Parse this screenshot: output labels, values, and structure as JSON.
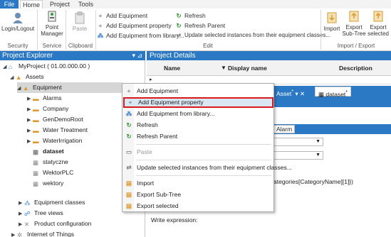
{
  "ribbon_tabs": [
    "File",
    "Home",
    "Project",
    "Tools"
  ],
  "ribbon": {
    "login_logout": "Login/Logout",
    "point_manager_l1": "Point",
    "point_manager_l2": "Manager",
    "paste": "Paste",
    "add_equipment": "Add Equipment",
    "add_equipment_property": "Add Equipment property",
    "add_equipment_from_library": "Add Equipment from library...",
    "refresh": "Refresh",
    "refresh_parent": "Refresh Parent",
    "update_selected": "Update selected instances from their equipment classes...",
    "import": "Import",
    "export_subtree_l1": "Export",
    "export_subtree_l2": "Sub-Tree",
    "export_selected_l1": "Export",
    "export_selected_l2": "selected",
    "groups": {
      "security": "Security",
      "service": "Service",
      "clipboard": "Clipboard",
      "edit": "Edit",
      "import_export": "Import / Export"
    }
  },
  "project_explorer": {
    "title": "Project Explorer",
    "tree": {
      "project": "MyProject ( 01.00.000.00 )",
      "assets": "Assets",
      "equipment": "Equipment",
      "children": [
        "Alarms",
        "Company",
        "GenDemoRoot",
        "Water Treatment",
        "WaterIrrigation",
        "dataset",
        "statyczne",
        "WektorPLC",
        "wektory"
      ],
      "equipment_classes": "Equipment classes",
      "tree_views": "Tree views",
      "product_configuration": "Product configuration",
      "internet_of_things": "Internet of Things"
    }
  },
  "project_details": {
    "title": "Project Details",
    "columns": [
      "Name",
      "Display name",
      "Description"
    ],
    "doc_tab_asset": "Asset",
    "doc_tab_dataset": "dataset",
    "alarm_tab": "Alarm",
    "expression_fragment": "ategories[CategoryName][1]})",
    "write_expression_label": "Write expression:"
  },
  "context_menu": {
    "items": [
      {
        "label": "Add Equipment",
        "icon": "plus-icon"
      },
      {
        "label": "Add Equipment property",
        "icon": "plus-icon"
      },
      {
        "label": "Add Equipment from library...",
        "icon": "library-icon"
      },
      {
        "label": "Refresh",
        "icon": "refresh-icon"
      },
      {
        "label": "Refresh Parent",
        "icon": "refresh-icon"
      },
      {
        "label": "Paste",
        "icon": "paste-icon"
      },
      {
        "label": "Update selected instances from their equipment classes...",
        "icon": "update-icon"
      },
      {
        "label": "Import",
        "icon": "import-icon"
      },
      {
        "label": "Export Sub-Tree",
        "icon": "export-icon"
      },
      {
        "label": "Export selected",
        "icon": "export-icon"
      }
    ],
    "highlighted": "Add Equipment property"
  },
  "colors": {
    "accent": "#2b78c5",
    "highlight_border": "#d9191e",
    "highlight_fill": "#d9e6f4"
  }
}
